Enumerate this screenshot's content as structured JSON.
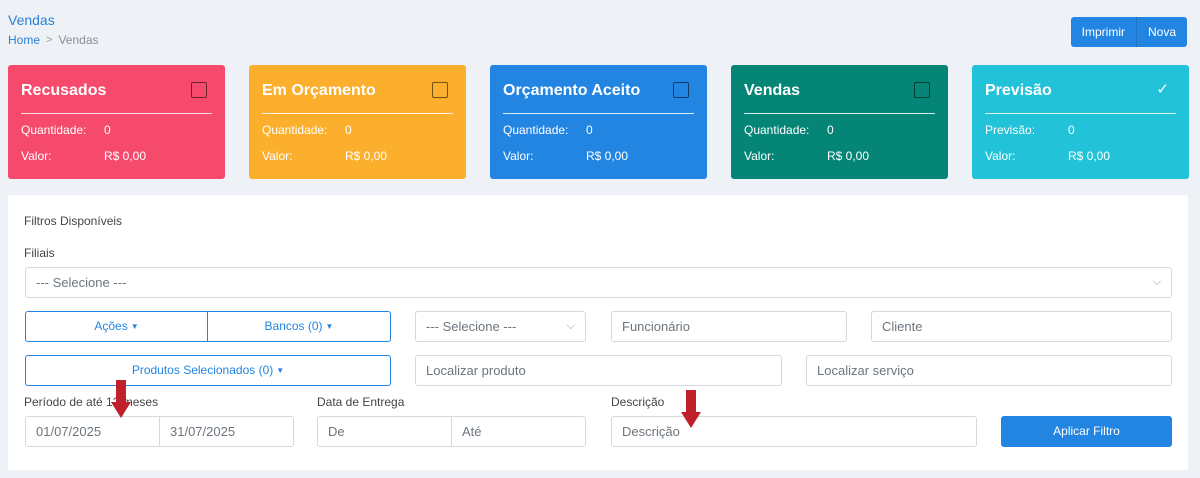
{
  "header": {
    "title": "Vendas",
    "breadcrumb_home": "Home",
    "breadcrumb_separator": ">",
    "breadcrumb_current": "Vendas",
    "print_label": "Imprimir",
    "new_label": "Nova"
  },
  "cards": [
    {
      "title": "Recusados",
      "color": "#f54a6b",
      "checked": false,
      "row1_label": "Quantidade:",
      "row1_value": "0",
      "row2_label": "Valor:",
      "row2_value": "R$ 0,00"
    },
    {
      "title": "Em Orçamento",
      "color": "#fcaf2c",
      "checked": false,
      "row1_label": "Quantidade:",
      "row1_value": "0",
      "row2_label": "Valor:",
      "row2_value": "R$ 0,00"
    },
    {
      "title": "Orçamento Aceito",
      "color": "#2385e2",
      "checked": false,
      "row1_label": "Quantidade:",
      "row1_value": "0",
      "row2_label": "Valor:",
      "row2_value": "R$ 0,00"
    },
    {
      "title": "Vendas",
      "color": "#058576",
      "checked": false,
      "row1_label": "Quantidade:",
      "row1_value": "0",
      "row2_label": "Valor:",
      "row2_value": "R$ 0,00"
    },
    {
      "title": "Previsão",
      "color": "#22c2d8",
      "checked": true,
      "row1_label": "Previsão:",
      "row1_value": "0",
      "row2_label": "Valor:",
      "row2_value": "R$ 0,00"
    }
  ],
  "filters": {
    "heading": "Filtros Disponíveis",
    "filiais_label": "Filiais",
    "filiais_value": "--- Selecione ---",
    "acoes_label": "Ações",
    "bancos_label": "Bancos (0)",
    "select_value": "--- Selecione ---",
    "funcionario_placeholder": "Funcionário",
    "cliente_placeholder": "Cliente",
    "produtos_label": "Produtos Selecionados (0)",
    "produto_placeholder": "Localizar produto",
    "servico_placeholder": "Localizar serviço",
    "periodo_label": "Período de até 12 meses",
    "periodo_start": "01/07/2025",
    "periodo_end": "31/07/2025",
    "entrega_label": "Data de Entrega",
    "entrega_de": "De",
    "entrega_ate": "Até",
    "descricao_label": "Descrição",
    "descricao_placeholder": "Descrição",
    "apply_label": "Aplicar Filtro"
  },
  "colors": {
    "accent": "#2385e2",
    "arrow": "#c0202a"
  }
}
